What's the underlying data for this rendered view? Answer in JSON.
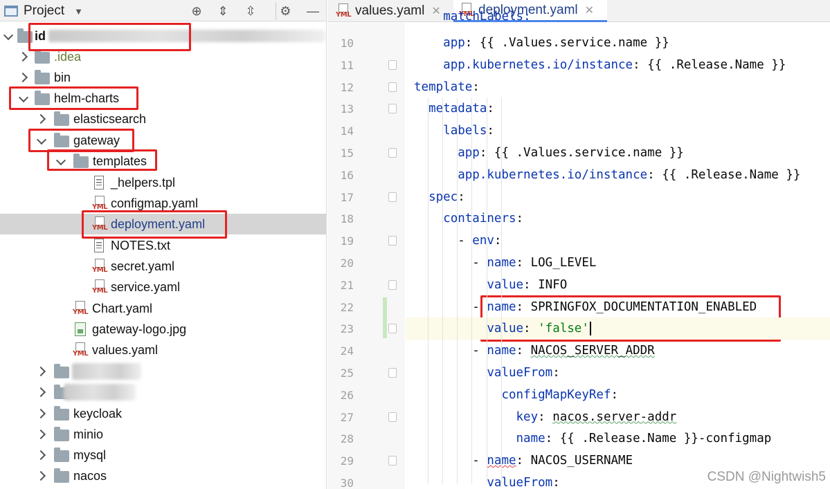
{
  "project_panel": {
    "title": "Project",
    "tree": {
      "root_label_visible": "id",
      "items": [
        {
          "label": ".idea"
        },
        {
          "label": "bin"
        },
        {
          "label": "helm-charts"
        },
        {
          "label": "elasticsearch"
        },
        {
          "label": "gateway"
        },
        {
          "label": "templates"
        },
        {
          "label": "_helpers.tpl"
        },
        {
          "label": "configmap.yaml"
        },
        {
          "label": "deployment.yaml"
        },
        {
          "label": "NOTES.txt"
        },
        {
          "label": "secret.yaml"
        },
        {
          "label": "service.yaml"
        },
        {
          "label": "Chart.yaml"
        },
        {
          "label": "gateway-logo.jpg"
        },
        {
          "label": "values.yaml"
        },
        {
          "label": "keycloak"
        },
        {
          "label": "minio"
        },
        {
          "label": "mysql"
        },
        {
          "label": "nacos"
        }
      ]
    },
    "icons": [
      "project-window-icon",
      "dropdown-icon",
      "locate-icon",
      "expand-all-icon",
      "collapse-all-icon",
      "settings-icon",
      "hide-icon"
    ]
  },
  "editor": {
    "tabs": [
      {
        "label": "values.yaml",
        "active": false
      },
      {
        "label": "deployment.yaml",
        "active": true
      }
    ],
    "yml_badge": "YML",
    "lines": [
      {
        "num": "10",
        "key": "app",
        "sep": ": ",
        "value": "{{ .Values.service.name }}"
      },
      {
        "num": "11",
        "key": "app.kubernetes.io/instance",
        "sep": ": ",
        "value": "{{ .Release.Name }}"
      },
      {
        "num": "12",
        "key": "template",
        "sep": ":",
        "value": ""
      },
      {
        "num": "13",
        "key": "metadata",
        "sep": ":",
        "value": ""
      },
      {
        "num": "14",
        "key": "labels",
        "sep": ":",
        "value": ""
      },
      {
        "num": "15",
        "key": "app",
        "sep": ": ",
        "value": "{{ .Values.service.name }}"
      },
      {
        "num": "16",
        "key": "app.kubernetes.io/instance",
        "sep": ": ",
        "value": "{{ .Release.Name }}"
      },
      {
        "num": "17",
        "key": "spec",
        "sep": ":",
        "value": ""
      },
      {
        "num": "18",
        "key": "containers",
        "sep": ":",
        "value": ""
      },
      {
        "num": "19",
        "dash": "- ",
        "key": "env",
        "sep": ":",
        "value": ""
      },
      {
        "num": "20",
        "dash": "- ",
        "key": "name",
        "sep": ": ",
        "value": "LOG_LEVEL"
      },
      {
        "num": "21",
        "key": "value",
        "sep": ": ",
        "value": "INFO"
      },
      {
        "num": "22",
        "dash": "- ",
        "key": "name",
        "sep": ": ",
        "value": "SPRINGFOX_DOCUMENTATION_ENABLED"
      },
      {
        "num": "23",
        "key": "value",
        "sep": ": ",
        "value": "'false'"
      },
      {
        "num": "24",
        "dash": "- ",
        "key": "name",
        "sep": ": ",
        "value": "NACOS_SERVER_ADDR"
      },
      {
        "num": "25",
        "key": "valueFrom",
        "sep": ":",
        "value": ""
      },
      {
        "num": "26",
        "key": "configMapKeyRef",
        "sep": ":",
        "value": ""
      },
      {
        "num": "27",
        "key": "key",
        "sep": ": ",
        "value": "nacos.server-addr"
      },
      {
        "num": "28",
        "key": "name",
        "sep": ": ",
        "value": "{{ .Release.Name }}-configmap"
      },
      {
        "num": "29",
        "dash": "- ",
        "key": "name",
        "sep": ": ",
        "value": "NACOS_USERNAME"
      },
      {
        "num": "30",
        "key": "valueFrom",
        "sep": ":",
        "value": ""
      }
    ],
    "partial_top_line_key": "matchLabels:"
  },
  "watermark": "CSDN @Nightwish5",
  "colors": {
    "yaml_key": "#0a35b0",
    "string_value": "#067d17",
    "annotation_box": "#e52222",
    "selection": "#d5d5d5"
  }
}
